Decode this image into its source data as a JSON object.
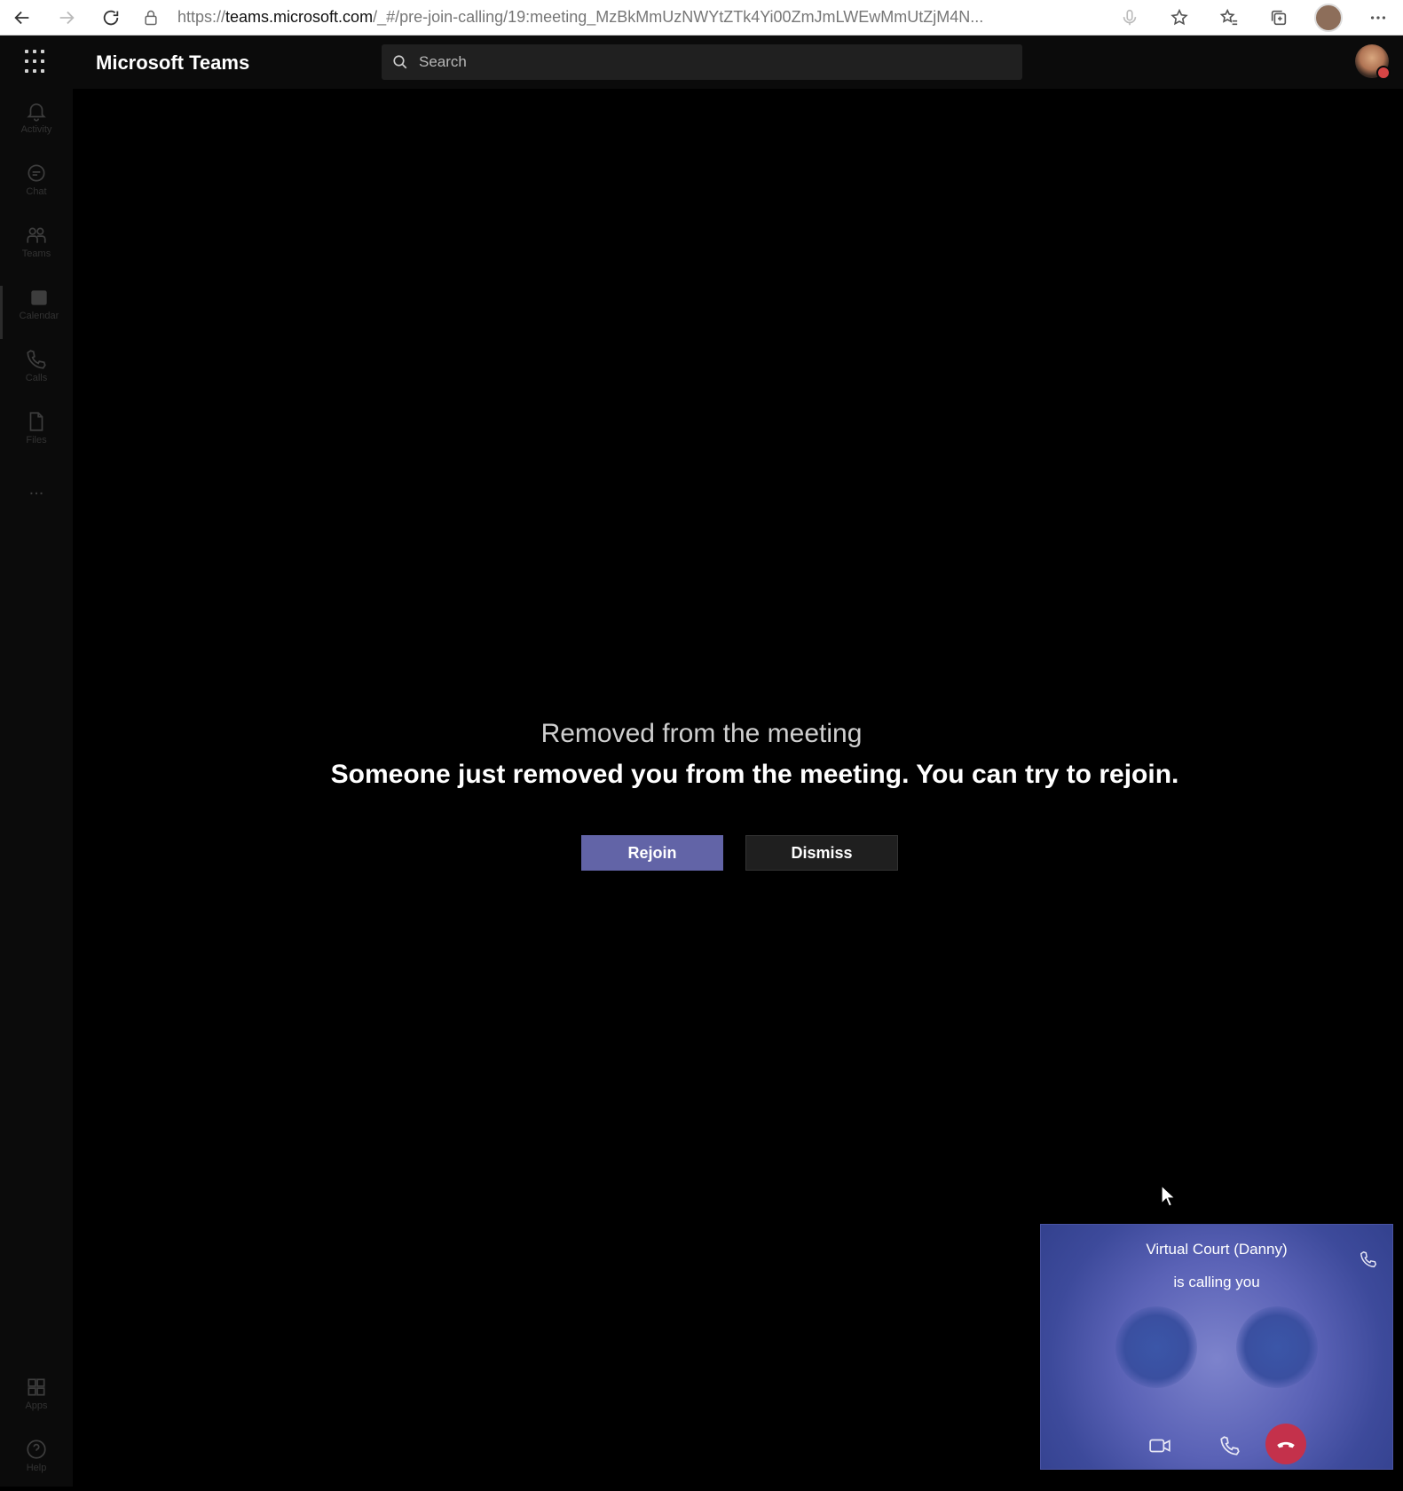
{
  "browser": {
    "url_scheme": "https://",
    "url_host": "teams.microsoft.com",
    "url_path": "/_#/pre-join-calling/19:meeting_MzBkMmUzNWYtZTk4Yi00ZmJmLWEwMmUtZjM4N..."
  },
  "header": {
    "app_title": "Microsoft Teams",
    "search_placeholder": "Search"
  },
  "rail": {
    "items": [
      {
        "label": "Activity",
        "icon": "bell-icon"
      },
      {
        "label": "Chat",
        "icon": "chat-icon"
      },
      {
        "label": "Teams",
        "icon": "teams-icon"
      },
      {
        "label": "Calendar",
        "icon": "calendar-icon"
      },
      {
        "label": "Calls",
        "icon": "phone-icon"
      },
      {
        "label": "Files",
        "icon": "file-icon"
      }
    ],
    "more": "...",
    "bottom": [
      {
        "label": "Apps",
        "icon": "apps-icon"
      },
      {
        "label": "Help",
        "icon": "help-icon"
      }
    ]
  },
  "notice": {
    "title": "Removed from the meeting",
    "body": "Someone just removed you from the meeting. You can try to rejoin.",
    "rejoin_label": "Rejoin",
    "dismiss_label": "Dismiss"
  },
  "call": {
    "caller": "Virtual Court (Danny)",
    "status": "is calling you"
  },
  "colors": {
    "accent": "#6264a7",
    "decline": "#c4314b",
    "background": "#000000"
  }
}
